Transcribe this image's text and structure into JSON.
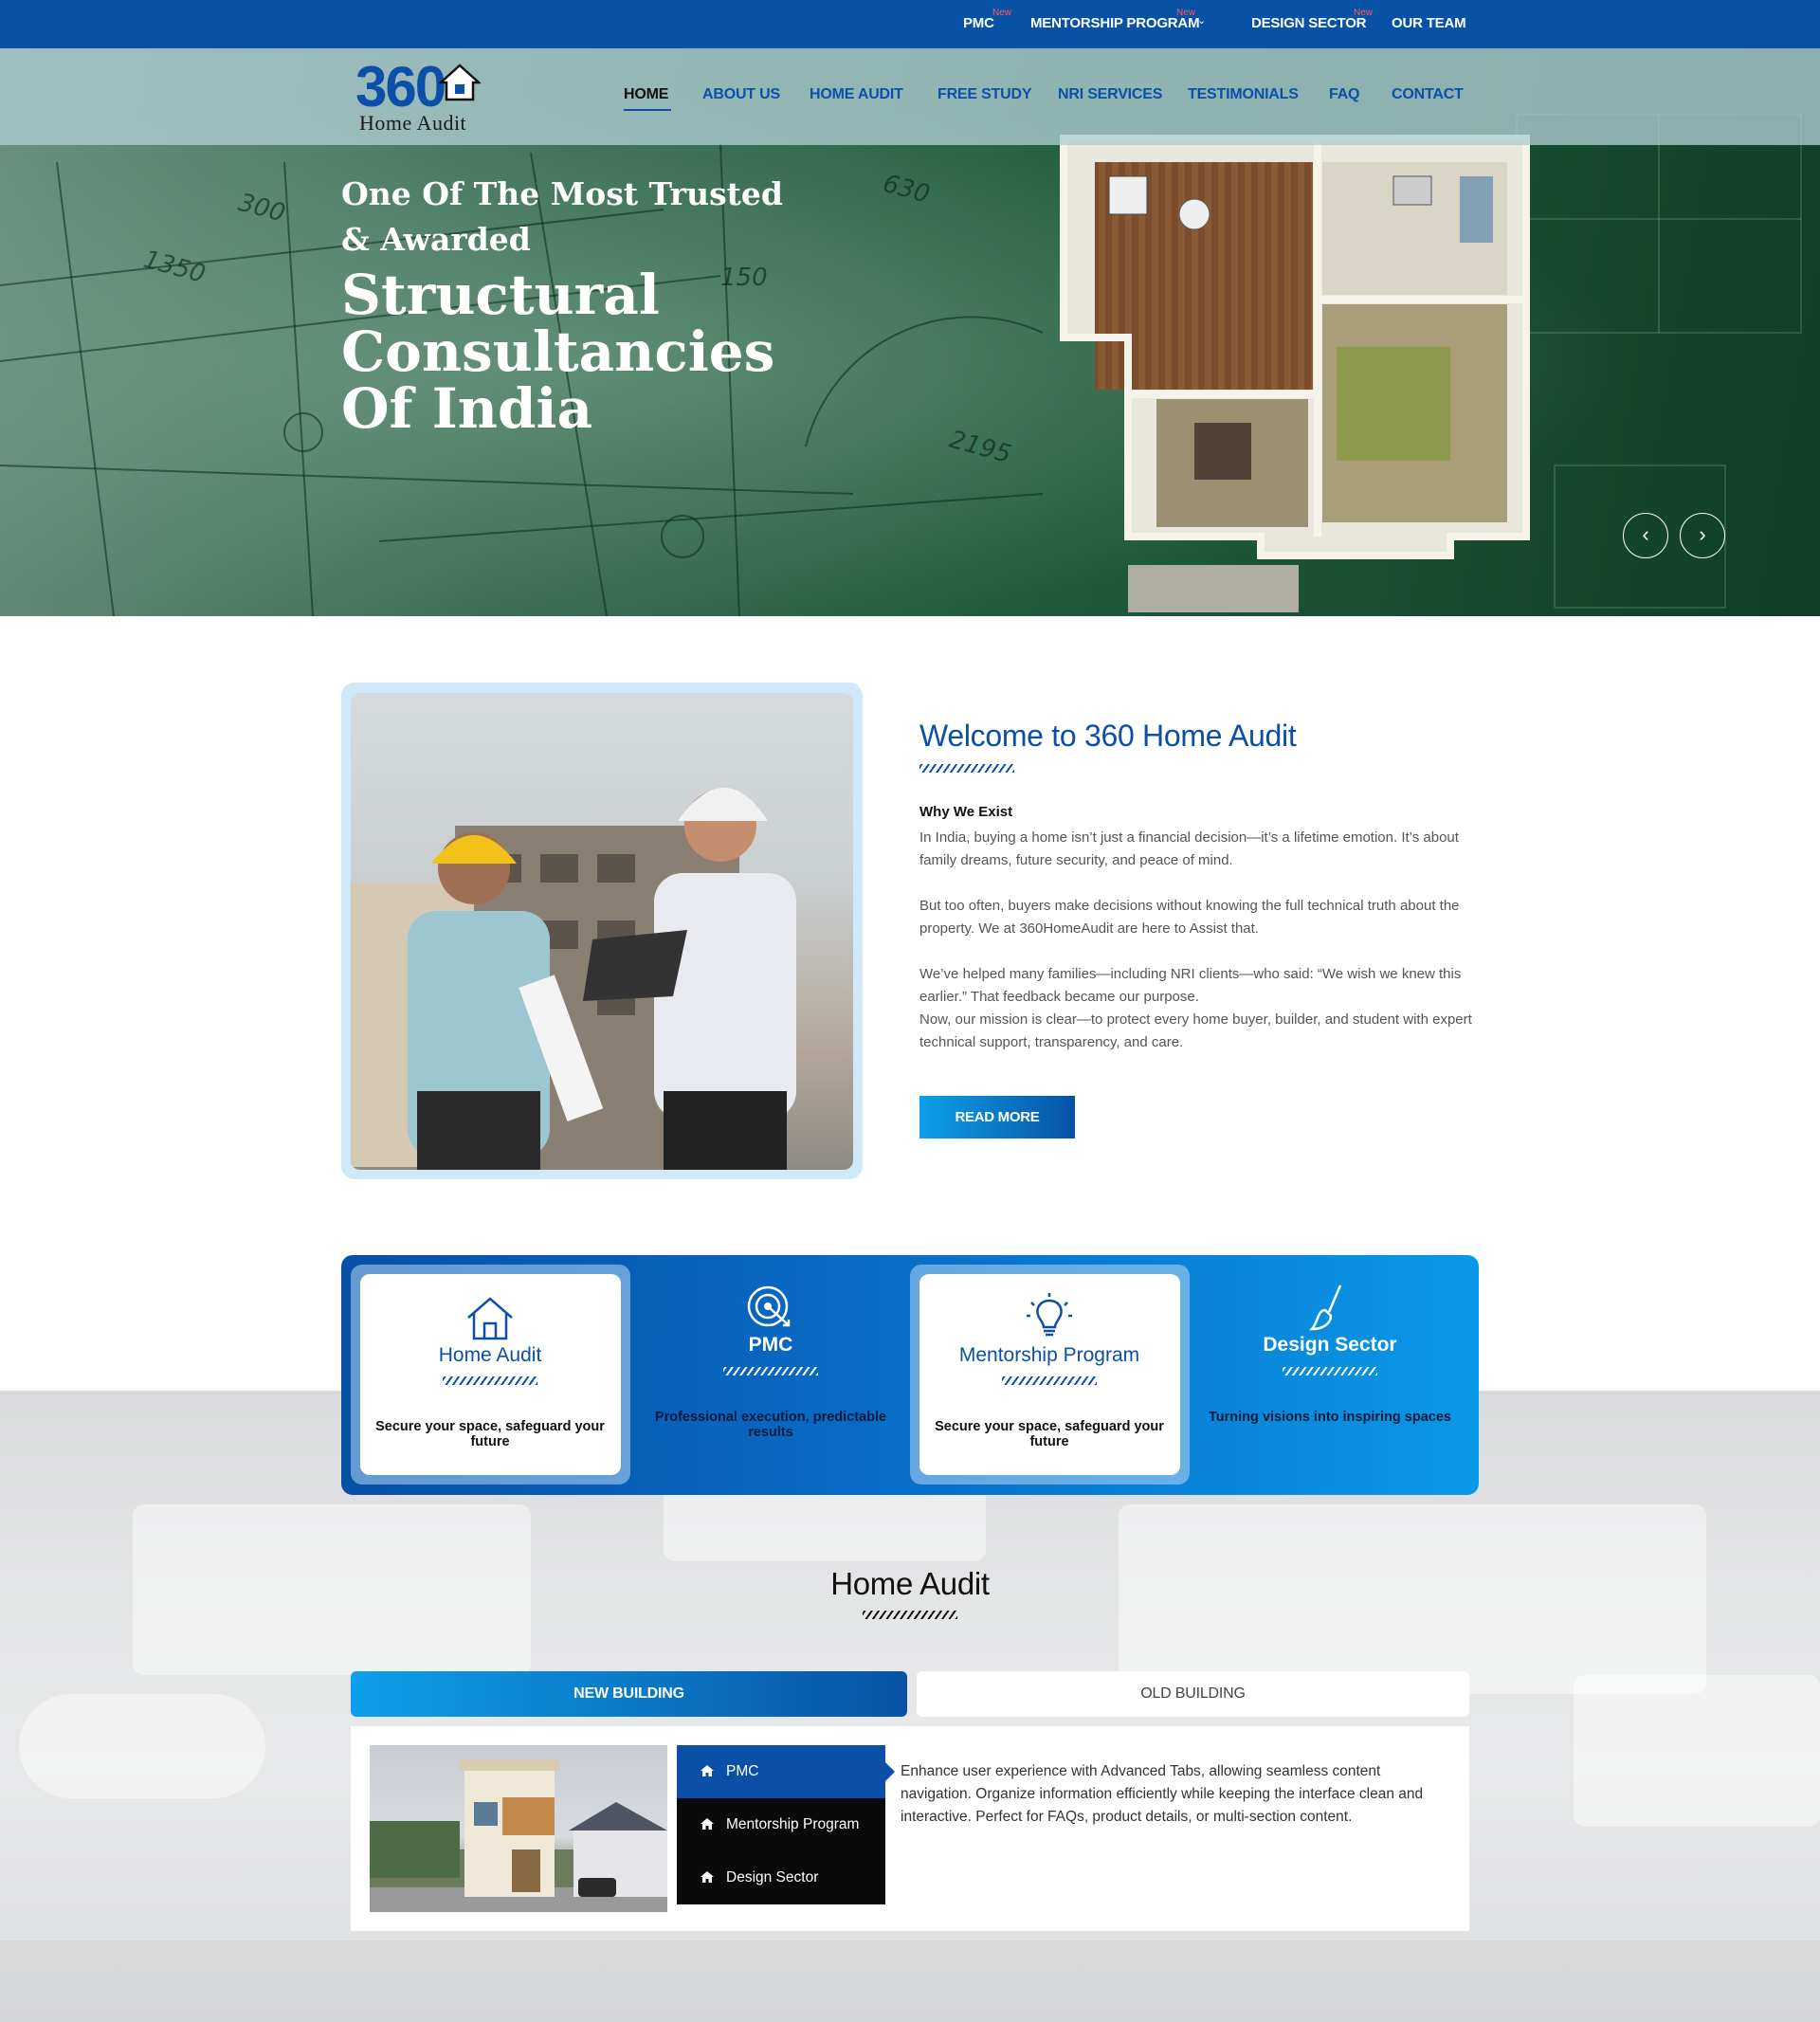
{
  "topbar": {
    "items": [
      {
        "label": "PMC",
        "badge": "New"
      },
      {
        "label": "MENTORSHIP PROGRAM",
        "badge": "New"
      },
      {
        "label": "DESIGN SECTOR",
        "badge": "New"
      },
      {
        "label": "OUR TEAM",
        "badge": ""
      }
    ]
  },
  "logo": {
    "number": "360",
    "text": "Home Audit"
  },
  "nav": {
    "items": [
      "HOME",
      "ABOUT US",
      "HOME AUDIT",
      "FREE STUDY",
      "NRI SERVICES",
      "TESTIMONIALS",
      "FAQ",
      "CONTACT"
    ],
    "active": "HOME"
  },
  "hero": {
    "line1": "One Of The Most Trusted",
    "line2": "& Awarded",
    "line3": "Structural",
    "line4": "Consultancies",
    "line5": "Of India",
    "prev": "‹",
    "next": "›"
  },
  "welcome": {
    "title": "Welcome to 360 Home Audit",
    "subtitle": "Why We Exist",
    "p1": "In India, buying a home isn’t just a financial decision—it’s a lifetime emotion. It’s about family dreams, future security, and peace of mind.",
    "p2": "But too often, buyers make decisions without knowing the full technical truth about the property. We at 360HomeAudit are here to Assist that.",
    "p3": "We’ve helped many families—including NRI clients—who said: “We wish we knew this earlier.” That feedback became our purpose.",
    "p4": "Now, our mission is clear—to protect every home buyer, builder, and student with expert technical support, transparency, and care.",
    "button": "READ MORE"
  },
  "services": [
    {
      "icon": "house-icon",
      "title": "Home Audit",
      "desc": "Secure your space, safeguard your future",
      "highlight": true
    },
    {
      "icon": "target-icon",
      "title": "PMC",
      "desc": "Professional execution, predictable results",
      "highlight": false
    },
    {
      "icon": "lightbulb-icon",
      "title": "Mentorship Program",
      "desc": "Secure your space, safeguard your future",
      "highlight": true
    },
    {
      "icon": "brush-icon",
      "title": "Design Sector",
      "desc": "Turning visions into inspiring spaces",
      "highlight": false
    }
  ],
  "home_audit": {
    "title": "Home Audit",
    "tabs": [
      "NEW BUILDING",
      "OLD BUILDING"
    ],
    "active_tab": "NEW BUILDING",
    "menu": [
      "PMC",
      "Mentorship Program",
      "Design Sector"
    ],
    "active_menu": "PMC",
    "content": "Enhance user experience with Advanced Tabs, allowing seamless content navigation. Organize information efficiently while keeping the interface clean and interactive. Perfect for FAQs, product details, or multi-section content."
  },
  "colors": {
    "primary": "#0752a6",
    "accent": "#0ea0ea",
    "badge": "#ff5a5a"
  }
}
